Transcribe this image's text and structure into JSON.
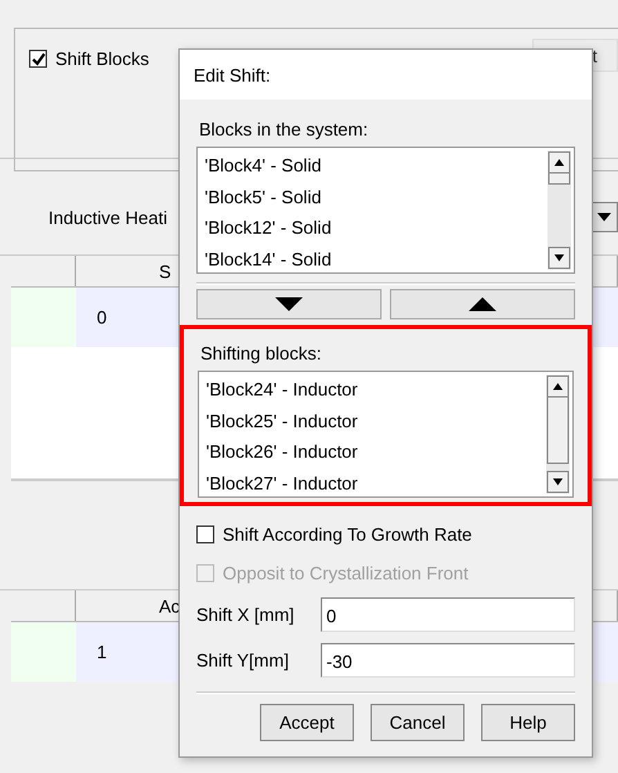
{
  "background": {
    "shift_blocks": {
      "label": "Shift Blocks",
      "checked": true
    },
    "button_text": "t",
    "heating_label": "Inductive Heati",
    "table_1": {
      "column_2": "S",
      "row": {
        "column_2": "0"
      }
    },
    "table_2": {
      "column_2": "Ac",
      "row": {
        "column_2": "1"
      }
    }
  },
  "dialog": {
    "title": "Edit Shift:",
    "blocks_label": "Blocks in the system:",
    "blocks": [
      "'Block4' - Solid",
      "'Block5' - Solid",
      "'Block12' - Solid",
      "'Block14' - Solid"
    ],
    "shifting_label": "Shifting blocks:",
    "shifting": [
      "'Block24' - Inductor",
      "'Block25' - Inductor",
      "'Block26' - Inductor",
      "'Block27' - Inductor"
    ],
    "options": [
      {
        "label": "Shift According To Growth Rate",
        "checked": false,
        "disabled": false
      },
      {
        "label": "Opposit to Crystallization Front",
        "checked": false,
        "disabled": true
      }
    ],
    "fields": [
      {
        "label": "Shift X [mm]",
        "value": "0"
      },
      {
        "label": "Shift Y[mm]",
        "value": "-30"
      }
    ],
    "buttons": [
      "Accept",
      "Cancel",
      "Help"
    ]
  }
}
